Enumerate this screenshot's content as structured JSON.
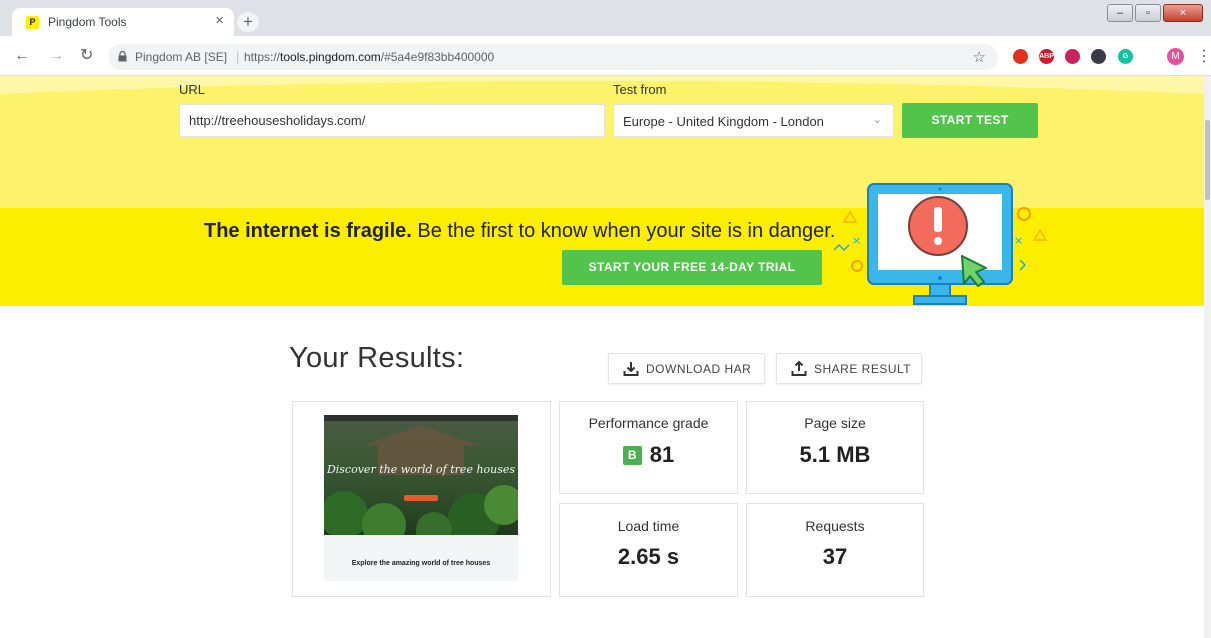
{
  "browser": {
    "tab_title": "Pingdom Tools",
    "tab_favicon_letter": "P",
    "tab_close": "×",
    "new_tab": "+",
    "url_org": "Pingdom AB [SE]",
    "url_scheme": "https://",
    "url_host": "tools.pingdom.com",
    "url_path": "/#5a4e9f83bb400000",
    "profile_initial": "M",
    "extensions": [
      {
        "name": "opera-icon",
        "color": "#e0311f"
      },
      {
        "name": "adblock-plus-icon",
        "color": "#d3182d",
        "label": "ABP"
      },
      {
        "name": "extension-red-icon",
        "color": "#c8255b"
      },
      {
        "name": "extension-dark-icon",
        "color": "#3a3a46"
      },
      {
        "name": "grammarly-icon",
        "color": "#15c39a",
        "label": "G"
      }
    ]
  },
  "search": {
    "url_label": "URL",
    "url_value": "http://treehousesholidays.com/",
    "test_from_label": "Test from",
    "test_from_value": "Europe - United Kingdom - London",
    "start_button": "START TEST"
  },
  "banner": {
    "headline_bold": "The internet is fragile.",
    "headline_rest": " Be the first to know when your site is in danger.",
    "trial_button": "START YOUR FREE 14-DAY TRIAL"
  },
  "results": {
    "title": "Your Results:",
    "download_har": "DOWNLOAD HAR",
    "share_result": "SHARE RESULT",
    "thumbnail": {
      "hero_text": "Discover the world of tree houses",
      "explore_text": "Explore the amazing world of tree houses"
    },
    "performance_grade": {
      "label": "Performance grade",
      "letter": "B",
      "value": "81"
    },
    "page_size": {
      "label": "Page size",
      "value": "5.1 MB"
    },
    "load_time": {
      "label": "Load time",
      "value": "2.65 s"
    },
    "requests": {
      "label": "Requests",
      "value": "37"
    }
  },
  "colors": {
    "yellow_light": "#fcf36a",
    "yellow_banner": "#fdee00",
    "green_button": "#52c44c",
    "grade_green": "#4caf50"
  }
}
